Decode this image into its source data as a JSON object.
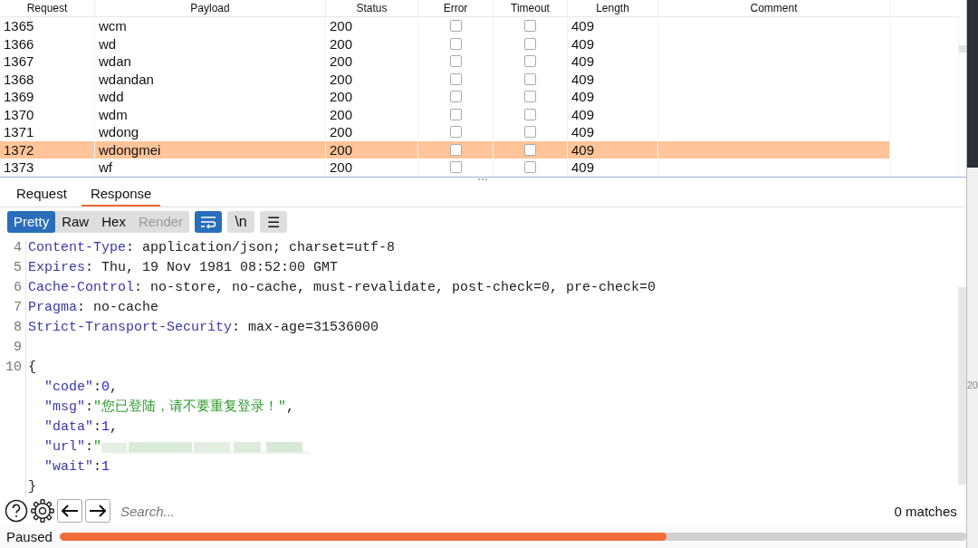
{
  "results_table": {
    "columns": [
      "Request",
      "Payload",
      "Status",
      "Error",
      "Timeout",
      "Length",
      "Comment"
    ],
    "rows": [
      {
        "request": "1365",
        "payload": "wcm",
        "status": "200",
        "error": false,
        "timeout": false,
        "length": "409",
        "selected": false
      },
      {
        "request": "1366",
        "payload": "wd",
        "status": "200",
        "error": false,
        "timeout": false,
        "length": "409",
        "selected": false
      },
      {
        "request": "1367",
        "payload": "wdan",
        "status": "200",
        "error": false,
        "timeout": false,
        "length": "409",
        "selected": false
      },
      {
        "request": "1368",
        "payload": "wdandan",
        "status": "200",
        "error": false,
        "timeout": false,
        "length": "409",
        "selected": false
      },
      {
        "request": "1369",
        "payload": "wdd",
        "status": "200",
        "error": false,
        "timeout": false,
        "length": "409",
        "selected": false
      },
      {
        "request": "1370",
        "payload": "wdm",
        "status": "200",
        "error": false,
        "timeout": false,
        "length": "409",
        "selected": false
      },
      {
        "request": "1371",
        "payload": "wdong",
        "status": "200",
        "error": false,
        "timeout": false,
        "length": "409",
        "selected": false
      },
      {
        "request": "1372",
        "payload": "wdongmei",
        "status": "200",
        "error": false,
        "timeout": false,
        "length": "409",
        "selected": true
      },
      {
        "request": "1373",
        "payload": "wf",
        "status": "200",
        "error": false,
        "timeout": false,
        "length": "409",
        "selected": false
      }
    ]
  },
  "detail_tabs": [
    {
      "label": "Request",
      "selected": false
    },
    {
      "label": "Response",
      "selected": true
    }
  ],
  "view_modes": [
    {
      "label": "Pretty",
      "selected": true,
      "disabled": false
    },
    {
      "label": "Raw",
      "selected": false,
      "disabled": false
    },
    {
      "label": "Hex",
      "selected": false,
      "disabled": false
    },
    {
      "label": "Render",
      "selected": false,
      "disabled": true
    }
  ],
  "toolbar_toggles": [
    {
      "kind": "wrap",
      "selected": true
    },
    {
      "kind": "text",
      "label": "\\n",
      "selected": false
    },
    {
      "kind": "text",
      "label": "☰",
      "selected": false
    }
  ],
  "response_lines": [
    {
      "number": "4",
      "segments": [
        {
          "kind": "name",
          "text": "Content-Type"
        },
        {
          "kind": "plain",
          "text": ": application/json; charset=utf-8"
        }
      ]
    },
    {
      "number": "5",
      "segments": [
        {
          "kind": "name",
          "text": "Expires"
        },
        {
          "kind": "plain",
          "text": ": Thu, 19 Nov 1981 08:52:00 GMT"
        }
      ]
    },
    {
      "number": "6",
      "segments": [
        {
          "kind": "name",
          "text": "Cache-Control"
        },
        {
          "kind": "plain",
          "text": ": no-store, no-cache, must-revalidate, post-check=0, pre-check=0"
        }
      ]
    },
    {
      "number": "7",
      "segments": [
        {
          "kind": "name",
          "text": "Pragma"
        },
        {
          "kind": "plain",
          "text": ": no-cache"
        }
      ]
    },
    {
      "number": "8",
      "segments": [
        {
          "kind": "name",
          "text": "Strict-Transport-Security"
        },
        {
          "kind": "plain",
          "text": ": max-age=31536000"
        }
      ]
    },
    {
      "number": "9"
    },
    {
      "number": "10",
      "segments": [
        {
          "kind": "plain",
          "text": "{"
        }
      ],
      "children": [
        {
          "segments": [
            {
              "kind": "key",
              "text": "\"code\""
            },
            {
              "kind": "plain",
              "text": ":"
            },
            {
              "kind": "number",
              "text": "0"
            },
            {
              "kind": "plain",
              "text": ","
            }
          ]
        },
        {
          "segments": [
            {
              "kind": "key",
              "text": "\"msg\""
            },
            {
              "kind": "plain",
              "text": ":"
            },
            {
              "kind": "string",
              "text": "\"您已登陆，请不要重复登录！\""
            },
            {
              "kind": "plain",
              "text": ","
            }
          ]
        },
        {
          "segments": [
            {
              "kind": "key",
              "text": "\"data\""
            },
            {
              "kind": "plain",
              "text": ":"
            },
            {
              "kind": "number",
              "text": "1"
            },
            {
              "kind": "plain",
              "text": ","
            }
          ]
        },
        {
          "segments": [
            {
              "kind": "key",
              "text": "\"url\""
            },
            {
              "kind": "plain",
              "text": ":"
            },
            {
              "kind": "string",
              "text": "\""
            },
            {
              "kind": "redacted"
            }
          ]
        },
        {
          "segments": [
            {
              "kind": "key",
              "text": "\"wait\""
            },
            {
              "kind": "plain",
              "text": ":"
            },
            {
              "kind": "number",
              "text": "1"
            }
          ]
        }
      ]
    },
    {
      "segments": [
        {
          "kind": "plain",
          "text": "}"
        }
      ]
    }
  ],
  "side_text": "20",
  "search": {
    "placeholder": "Search...",
    "matches": "0 matches"
  },
  "status_bar": {
    "state": "Paused",
    "progress": {
      "level": 0.67
    }
  }
}
